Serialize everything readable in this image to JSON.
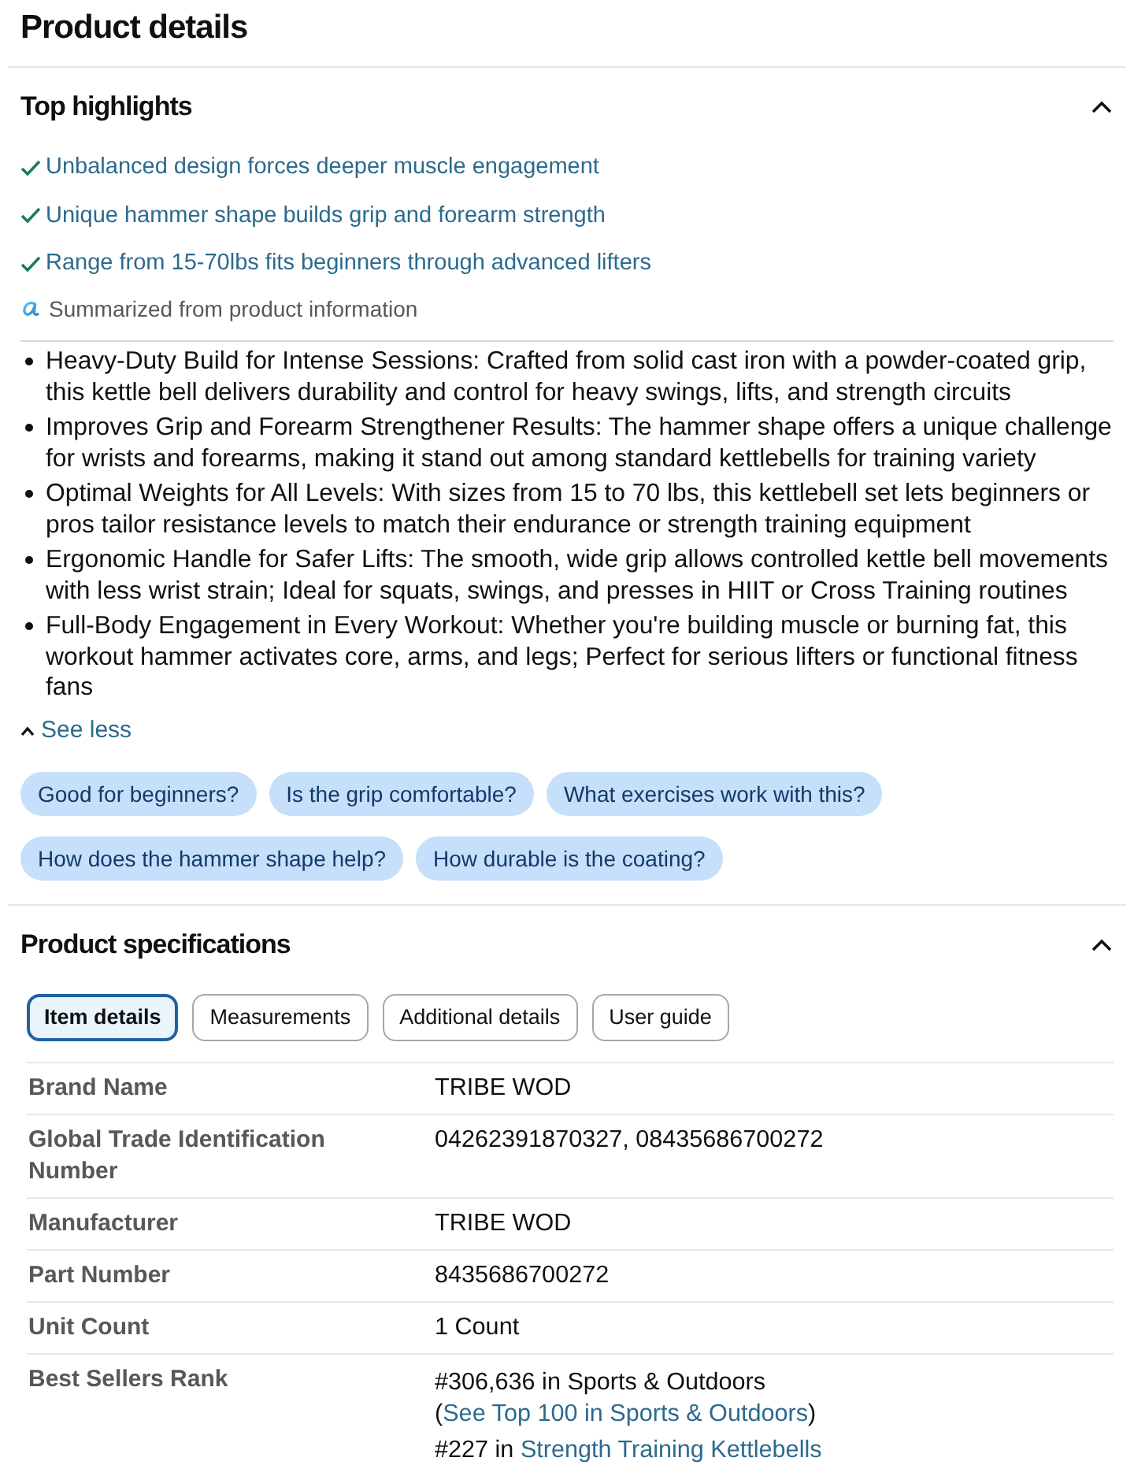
{
  "page": {
    "title": "Product details"
  },
  "top_highlights": {
    "title": "Top highlights",
    "expanded": true,
    "highlights": [
      "Unbalanced design forces deeper muscle engagement",
      "Unique hammer shape builds grip and forearm strength",
      "Range from 15-70lbs fits beginners through advanced lifters"
    ],
    "summary_note": "Summarized from product information",
    "bullets": [
      "Heavy-Duty Build for Intense Sessions: Crafted from solid cast iron with a powder-coated grip, this kettle bell delivers durability and control for heavy swings, lifts, and strength circuits",
      "Improves Grip and Forearm Strengthener Results: The hammer shape offers a unique challenge for wrists and forearms, making it stand out among standard kettlebells for training variety",
      "Optimal Weights for All Levels: With sizes from 15 to 70 lbs, this kettlebell set lets beginners or pros tailor resistance levels to match their endurance or strength training equipment",
      "Ergonomic Handle for Safer Lifts: The smooth, wide grip allows controlled kettle bell movements with less wrist strain; Ideal for squats, swings, and presses in HIIT or Cross Training routines",
      "Full-Body Engagement in Every Workout: Whether you're building muscle or burning fat, this workout hammer activates core, arms, and legs; Perfect for serious lifters or functional fitness fans"
    ],
    "see_less": "See less",
    "questions": [
      "Good for beginners?",
      "Is the grip comfortable?",
      "What exercises work with this?",
      "How does the hammer shape help?",
      "How durable is the coating?"
    ]
  },
  "product_specifications": {
    "title": "Product specifications",
    "expanded": true,
    "tabs": [
      {
        "label": "Item details",
        "selected": true
      },
      {
        "label": "Measurements",
        "selected": false
      },
      {
        "label": "Additional details",
        "selected": false
      },
      {
        "label": "User guide",
        "selected": false
      }
    ],
    "rows": [
      {
        "kind": "text",
        "label": "Brand Name",
        "value": "TRIBE WOD"
      },
      {
        "kind": "text",
        "label": "Global Trade Identification Number",
        "value": "04262391870327, 08435686700272"
      },
      {
        "kind": "text",
        "label": "Manufacturer",
        "value": "TRIBE WOD"
      },
      {
        "kind": "text",
        "label": "Part Number",
        "value": "8435686700272"
      },
      {
        "kind": "text",
        "label": "Unit Count",
        "value": "1 Count"
      },
      {
        "kind": "ranks",
        "label": "Best Sellers Rank",
        "ranks": [
          {
            "text": "#306,636 in Sports & Outdoors (",
            "link": "See Top 100 in Sports & Outdoors",
            "after": ")"
          },
          {
            "text": "#227 in ",
            "link": "Strength Training Kettlebells"
          }
        ]
      }
    ]
  }
}
